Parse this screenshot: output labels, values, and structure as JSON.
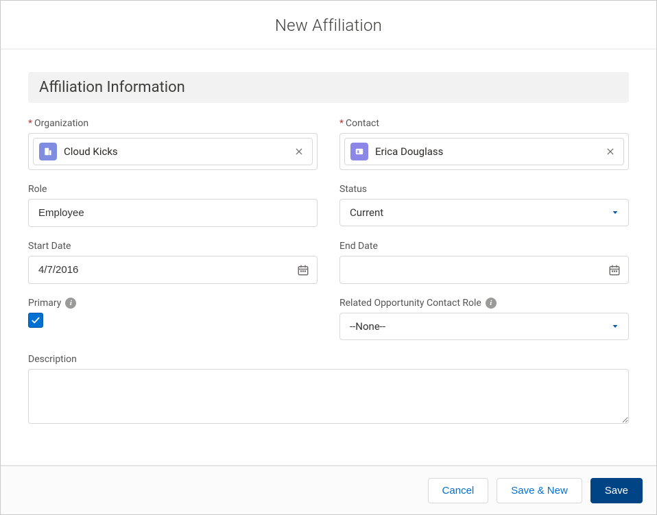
{
  "modal": {
    "title": "New Affiliation"
  },
  "section": {
    "header": "Affiliation Information"
  },
  "fields": {
    "organization": {
      "label": "Organization",
      "required": true,
      "value": "Cloud Kicks"
    },
    "contact": {
      "label": "Contact",
      "required": true,
      "value": "Erica Douglass"
    },
    "role": {
      "label": "Role",
      "value": "Employee"
    },
    "status": {
      "label": "Status",
      "value": "Current"
    },
    "start_date": {
      "label": "Start Date",
      "value": "4/7/2016"
    },
    "end_date": {
      "label": "End Date",
      "value": ""
    },
    "primary": {
      "label": "Primary",
      "checked": true
    },
    "related_opp_role": {
      "label": "Related Opportunity Contact Role",
      "value": "--None--"
    },
    "description": {
      "label": "Description",
      "value": ""
    }
  },
  "footer": {
    "cancel": "Cancel",
    "save_new": "Save & New",
    "save": "Save"
  }
}
